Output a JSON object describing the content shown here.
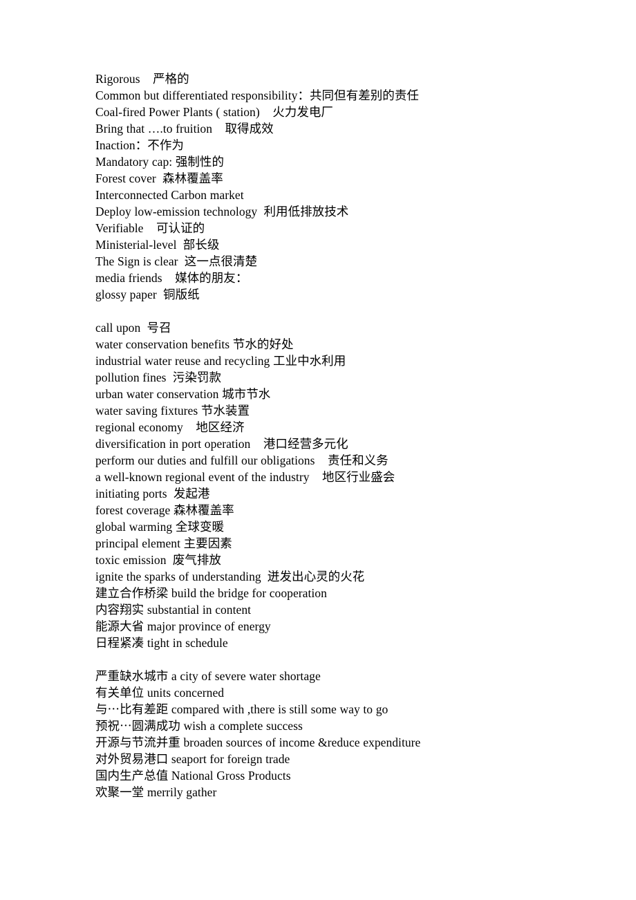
{
  "document": {
    "page_background": "#ffffff",
    "text_color": "#000000",
    "blocks": [
      {
        "id": "climate-glossary",
        "lines": [
          "Rigorous    严格的",
          "Common but differentiated responsibility：共同但有差别的责任",
          "Coal-fired Power Plants ( station)    火力发电厂",
          "Bring that ….to fruition    取得成效",
          "Inaction：不作为",
          "Mandatory cap: 强制性的",
          "Forest cover  森林覆盖率",
          "Interconnected Carbon market",
          "Deploy low-emission technology  利用低排放技术",
          "Verifiable    可认证的",
          "Ministerial-level  部长级",
          "The Sign is clear  这一点很清楚",
          "media friends    媒体的朋友：",
          "glossy paper  铜版纸"
        ]
      },
      {
        "id": "water-and-port-glossary",
        "lines": [
          "call upon  号召",
          "water conservation benefits 节水的好处",
          "industrial water reuse and recycling 工业中水利用",
          "pollution fines  污染罚款",
          "urban water conservation 城市节水",
          "water saving fixtures 节水装置",
          "regional economy    地区经济",
          "diversification in port operation    港口经营多元化",
          "perform our duties and fulfill our obligations    责任和义务",
          "a well-known regional event of the industry    地区行业盛会",
          "initiating ports  发起港",
          "forest coverage 森林覆盖率",
          "global warming 全球变暖",
          "principal element 主要因素",
          "toxic emission  废气排放",
          "ignite the sparks of understanding  迸发出心灵的火花",
          "建立合作桥梁 build the bridge for cooperation",
          "内容翔实 substantial in content",
          "能源大省 major province of energy",
          "日程紧凑 tight in schedule"
        ]
      },
      {
        "id": "chinese-first-glossary",
        "lines": [
          "严重缺水城市 a city of severe water shortage",
          "有关单位 units concerned",
          "与⋯比有差距 compared with ,there is still some way to go",
          "预祝⋯圆满成功 wish a complete success",
          "开源与节流并重 broaden sources of income &reduce expenditure",
          "对外贸易港口 seaport for foreign trade",
          "国内生产总值 National Gross Products",
          "欢聚一堂 merrily gather"
        ]
      }
    ]
  }
}
